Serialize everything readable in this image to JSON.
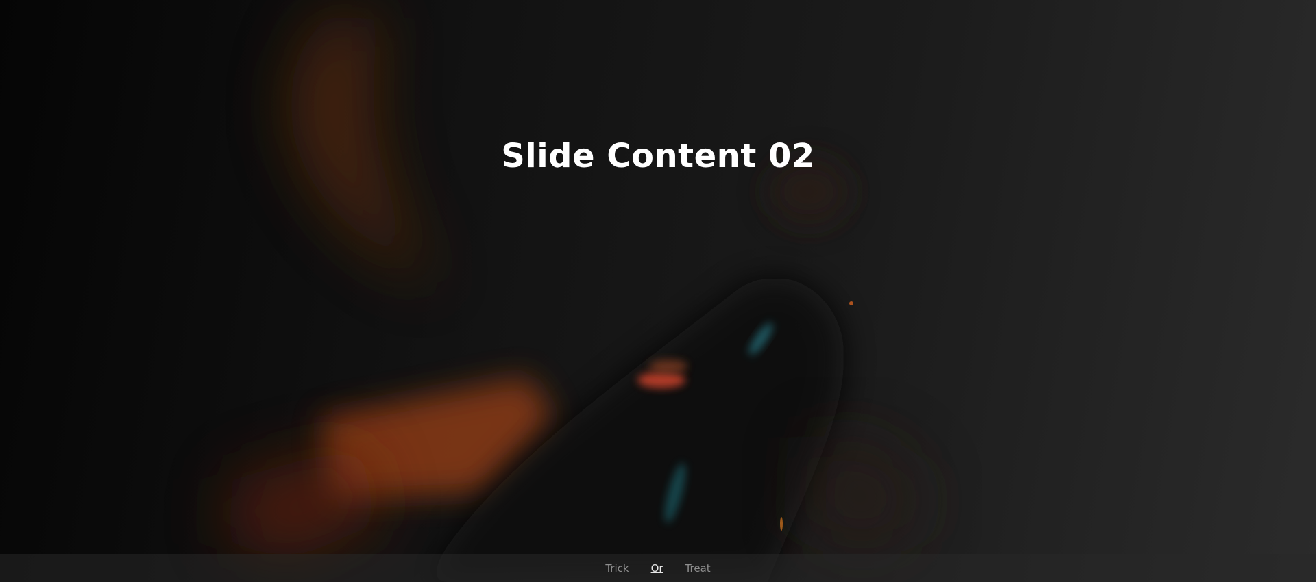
{
  "slide": {
    "title": "Slide Content 02"
  },
  "pagination": {
    "items": [
      {
        "label": "Trick",
        "active": false
      },
      {
        "label": "Or",
        "active": true
      },
      {
        "label": "Treat",
        "active": false
      }
    ]
  },
  "colors": {
    "title": "#ffffff",
    "pager_inactive": "#8e8e8e",
    "pager_active": "#e6e6e6",
    "accent_orange": "#c0521f",
    "accent_teal": "#2a8a9a"
  }
}
